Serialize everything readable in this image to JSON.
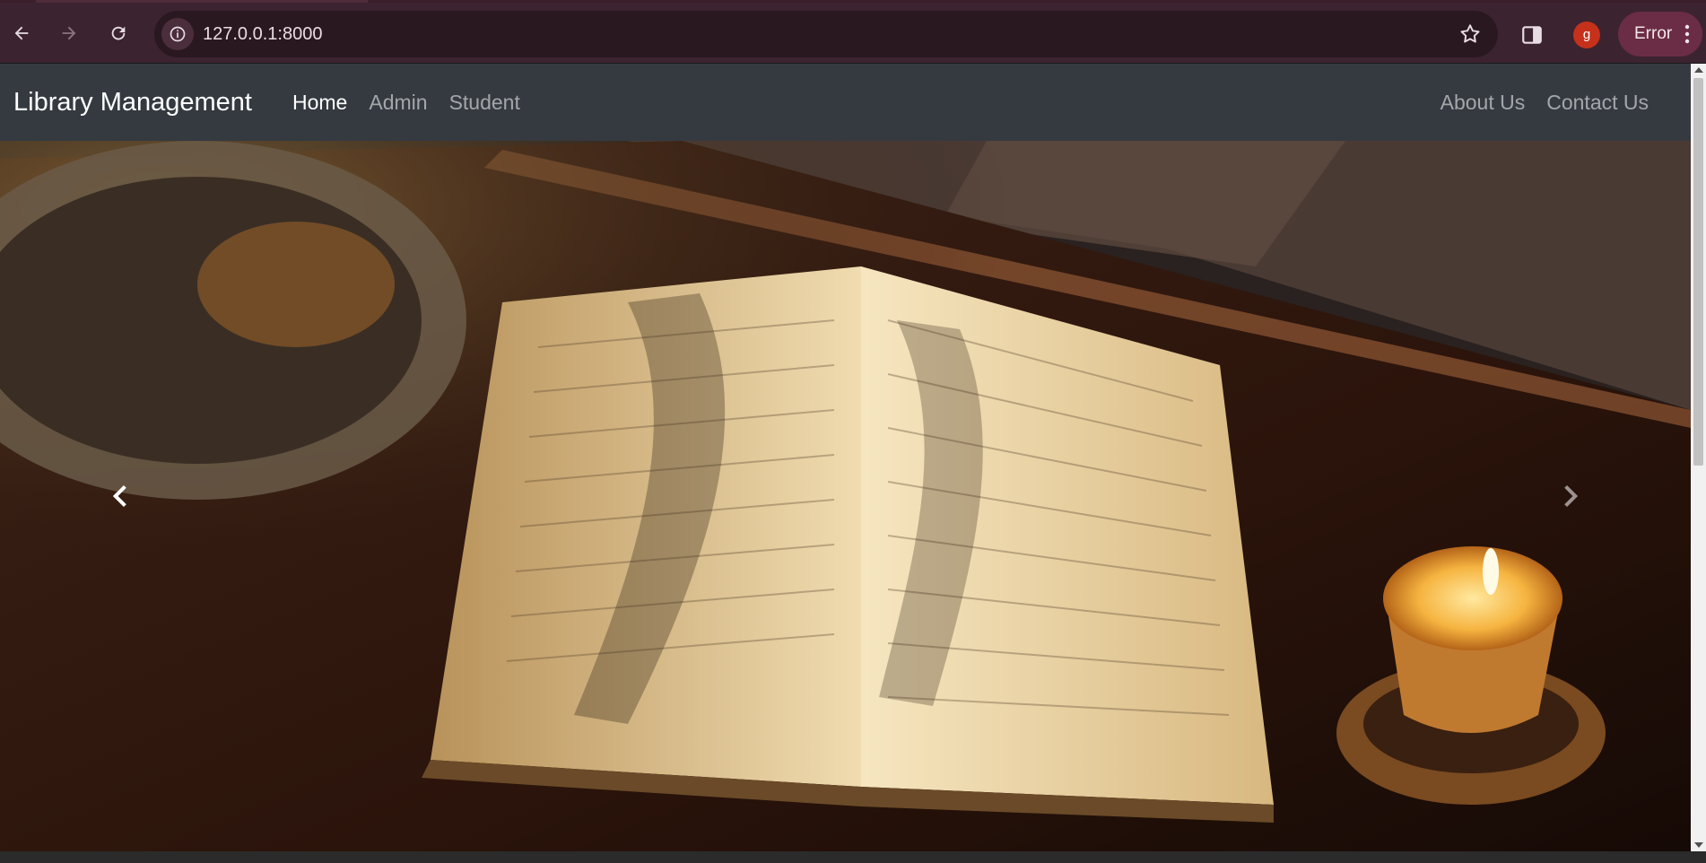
{
  "browser": {
    "url": "127.0.0.1:8000",
    "profile_initial": "g",
    "error_label": "Error",
    "colors": {
      "toolbar": "#3c2330",
      "omnibox": "#2a1820",
      "profile": "#c5311a",
      "error_pill": "#6b2d45"
    }
  },
  "navbar": {
    "brand": "Library Management",
    "left_links": [
      {
        "label": "Home",
        "active": true
      },
      {
        "label": "Admin",
        "active": false
      },
      {
        "label": "Student",
        "active": false
      }
    ],
    "right_links": [
      {
        "label": "About Us"
      },
      {
        "label": "Contact Us"
      }
    ],
    "colors": {
      "background": "#343a40",
      "link": "rgba(255,255,255,0.55)",
      "active": "#ffffff"
    }
  },
  "hero": {
    "image_description_icon": "open-book-candle-photo",
    "prev_icon": "chevron-left-icon",
    "next_icon": "chevron-right-icon"
  }
}
